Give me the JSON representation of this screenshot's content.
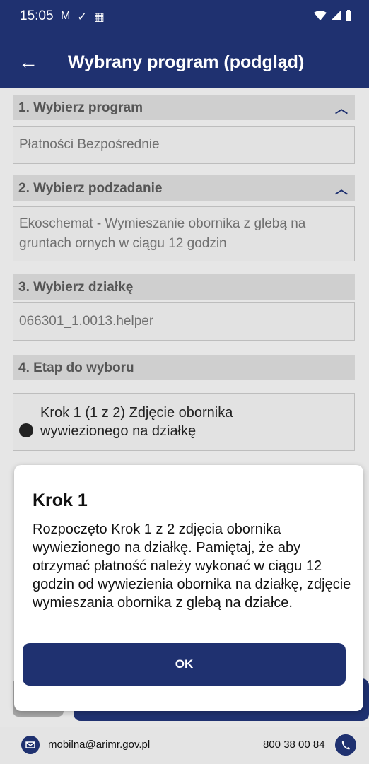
{
  "status_bar": {
    "time": "15:05"
  },
  "app_bar": {
    "back_icon": "arrow-left-icon",
    "title": "Wybrany program (podgląd)"
  },
  "sections": [
    {
      "header": "1. Wybierz program",
      "value": "Płatności Bezpośrednie",
      "expanded": true
    },
    {
      "header": "2. Wybierz podzadanie",
      "value": "Ekoschemat - Wymieszanie obornika z glebą na gruntach ornych w ciągu 12 godzin",
      "expanded": true
    },
    {
      "header": "3. Wybierz działkę",
      "value": "066301_1.0013.helper"
    },
    {
      "header": "4. Etap do wyboru",
      "option": "Krok 1 (1 z 2) Zdjęcie obornika wywiezionego na działkę"
    }
  ],
  "dialog": {
    "title": "Krok 1",
    "message": "Rozpoczęto Krok 1 z 2 zdjęcia obornika wywiezionego na działkę. Pamiętaj, że aby otrzymać płatność należy wykonać w ciągu 12 godzin od wywiezienia obornika na działkę, zdjęcie wymieszania obornika z glebą na działce.",
    "ok_label": "OK"
  },
  "footer": {
    "email": "mobilna@arimr.gov.pl",
    "phone": "800 38 00 84"
  },
  "colors": {
    "primary": "#1f3170"
  }
}
